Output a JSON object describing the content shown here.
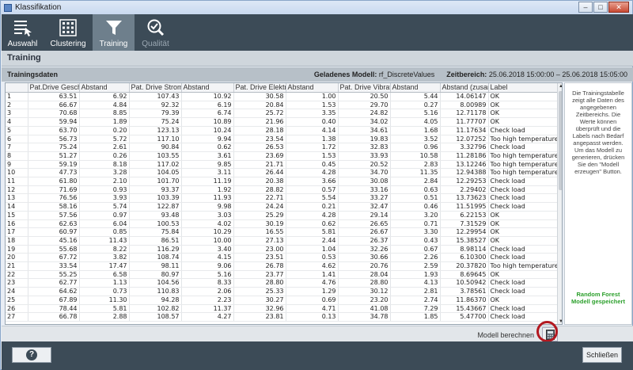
{
  "window": {
    "title": "Klassifikation"
  },
  "nav": [
    {
      "label": "Auswahl",
      "icon": "list-icon",
      "state": "normal"
    },
    {
      "label": "Clustering",
      "icon": "grid-icon",
      "state": "normal"
    },
    {
      "label": "Training",
      "icon": "funnel-icon",
      "state": "active"
    },
    {
      "label": "Qualität",
      "icon": "magnifier-check-icon",
      "state": "disabled"
    }
  ],
  "section": {
    "title": "Training"
  },
  "info": {
    "left": "Trainingsdaten",
    "model_label": "Geladenes Modell:",
    "model_value": "rf_DiscreteValues",
    "range_label": "Zeitbereich:",
    "range_value": "25.06.2018 15:00:00 – 25.06.2018 15:05:00"
  },
  "table": {
    "columns": [
      "",
      "Pat.Drive Geschw",
      "Abstand",
      "Pat. Drive Stroms",
      "Abstand",
      "Pat. Drive Elektri",
      "Abstand",
      "Pat. Drive Vibratio",
      "Abstand",
      "Abstand (zusamm",
      "Label"
    ],
    "rows": [
      [
        "1",
        "63.51",
        "6.92",
        "107.43",
        "10.92",
        "30.58",
        "1.00",
        "20.50",
        "5.44",
        "14.06147",
        "OK"
      ],
      [
        "2",
        "66.67",
        "4.84",
        "92.32",
        "6.19",
        "20.84",
        "1.53",
        "29.70",
        "0.27",
        "8.00989",
        "OK"
      ],
      [
        "3",
        "70.68",
        "8.85",
        "79.39",
        "6.74",
        "25.72",
        "3.35",
        "24.82",
        "5.16",
        "12.71178",
        "OK"
      ],
      [
        "4",
        "59.94",
        "1.89",
        "75.24",
        "10.89",
        "21.96",
        "0.40",
        "34.02",
        "4.05",
        "11.77707",
        "OK"
      ],
      [
        "5",
        "63.70",
        "0.20",
        "123.13",
        "10.24",
        "28.18",
        "4.14",
        "34.61",
        "1.68",
        "11.17634",
        "Check load"
      ],
      [
        "6",
        "56.73",
        "5.72",
        "117.10",
        "9.94",
        "23.54",
        "1.38",
        "19.83",
        "3.52",
        "12.07252",
        "Too high temperature"
      ],
      [
        "7",
        "75.24",
        "2.61",
        "90.84",
        "0.62",
        "26.53",
        "1.72",
        "32.83",
        "0.96",
        "3.32796",
        "Check load"
      ],
      [
        "8",
        "51.27",
        "0.26",
        "103.55",
        "3.61",
        "23.69",
        "1.53",
        "33.93",
        "10.58",
        "11.28186",
        "Too high temperature"
      ],
      [
        "9",
        "59.19",
        "8.18",
        "117.02",
        "9.85",
        "21.71",
        "0.45",
        "20.52",
        "2.83",
        "13.12246",
        "Too high temperature"
      ],
      [
        "10",
        "47.73",
        "3.28",
        "104.05",
        "3.11",
        "26.44",
        "4.28",
        "34.70",
        "11.35",
        "12.94388",
        "Too high temperature"
      ],
      [
        "11",
        "61.80",
        "2.10",
        "101.70",
        "11.19",
        "20.38",
        "3.66",
        "30.08",
        "2.84",
        "12.29253",
        "Check load"
      ],
      [
        "12",
        "71.69",
        "0.93",
        "93.37",
        "1.92",
        "28.82",
        "0.57",
        "33.16",
        "0.63",
        "2.29402",
        "Check load"
      ],
      [
        "13",
        "76.56",
        "3.93",
        "103.39",
        "11.93",
        "22.71",
        "5.54",
        "33.27",
        "0.51",
        "13.73623",
        "Check load"
      ],
      [
        "14",
        "58.16",
        "5.74",
        "122.87",
        "9.98",
        "24.24",
        "0.21",
        "32.47",
        "0.46",
        "11.51995",
        "Check load"
      ],
      [
        "15",
        "57.56",
        "0.97",
        "93.48",
        "3.03",
        "25.29",
        "4.28",
        "29.14",
        "3.20",
        "6.22153",
        "OK"
      ],
      [
        "16",
        "62.63",
        "6.04",
        "100.53",
        "4.02",
        "30.19",
        "0.62",
        "26.65",
        "0.71",
        "7.31529",
        "OK"
      ],
      [
        "17",
        "60.97",
        "0.85",
        "75.84",
        "10.29",
        "16.55",
        "5.81",
        "26.67",
        "3.30",
        "12.29954",
        "OK"
      ],
      [
        "18",
        "45.16",
        "11.43",
        "86.51",
        "10.00",
        "27.13",
        "2.44",
        "26.37",
        "0.43",
        "15.38527",
        "OK"
      ],
      [
        "19",
        "55.68",
        "8.22",
        "116.29",
        "3.40",
        "23.00",
        "1.04",
        "32.26",
        "0.67",
        "8.98114",
        "Check load"
      ],
      [
        "20",
        "67.72",
        "3.82",
        "108.74",
        "4.15",
        "23.51",
        "0.53",
        "30.66",
        "2.26",
        "6.10300",
        "Check load"
      ],
      [
        "21",
        "33.54",
        "17.47",
        "98.11",
        "9.06",
        "26.78",
        "4.62",
        "20.76",
        "2.59",
        "20.37820",
        "Too high temperature"
      ],
      [
        "22",
        "55.25",
        "6.58",
        "80.97",
        "5.16",
        "23.77",
        "1.41",
        "28.04",
        "1.93",
        "8.69645",
        "OK"
      ],
      [
        "23",
        "62.77",
        "1.13",
        "104.56",
        "8.33",
        "28.80",
        "4.76",
        "28.80",
        "4.13",
        "10.50942",
        "Check load"
      ],
      [
        "24",
        "64.62",
        "0.73",
        "110.83",
        "2.06",
        "25.33",
        "1.29",
        "30.12",
        "2.81",
        "3.78561",
        "Check load"
      ],
      [
        "25",
        "67.89",
        "11.30",
        "94.28",
        "2.23",
        "30.27",
        "0.69",
        "23.20",
        "2.74",
        "11.86370",
        "OK"
      ],
      [
        "26",
        "78.44",
        "5.81",
        "102.82",
        "11.37",
        "32.96",
        "4.71",
        "41.08",
        "7.29",
        "15.43667",
        "Check load"
      ],
      [
        "27",
        "66.78",
        "2.88",
        "108.57",
        "4.27",
        "23.81",
        "0.13",
        "34.78",
        "1.85",
        "5.47700",
        "Check load"
      ]
    ]
  },
  "side": {
    "text": "Die Trainingstabelle zeigt alle Daten des angegebenen Zeitbereichs. Die Werte können überprüft und die Labels nach Bedarf angepasst werden. Um das Modell zu generieren, drücken Sie den \"Modell erzeugen\" Button.",
    "status": "Random Forest Modell gespeichert"
  },
  "bottom": {
    "calc_label": "Modell berechnen"
  },
  "footer": {
    "help": "?",
    "close": "Schließen"
  },
  "colors": {
    "nav_bg": "#3c4b57",
    "nav_active": "#6e7f8c",
    "status_ok": "#2ca02c",
    "highlight_ring": "#b31820"
  }
}
